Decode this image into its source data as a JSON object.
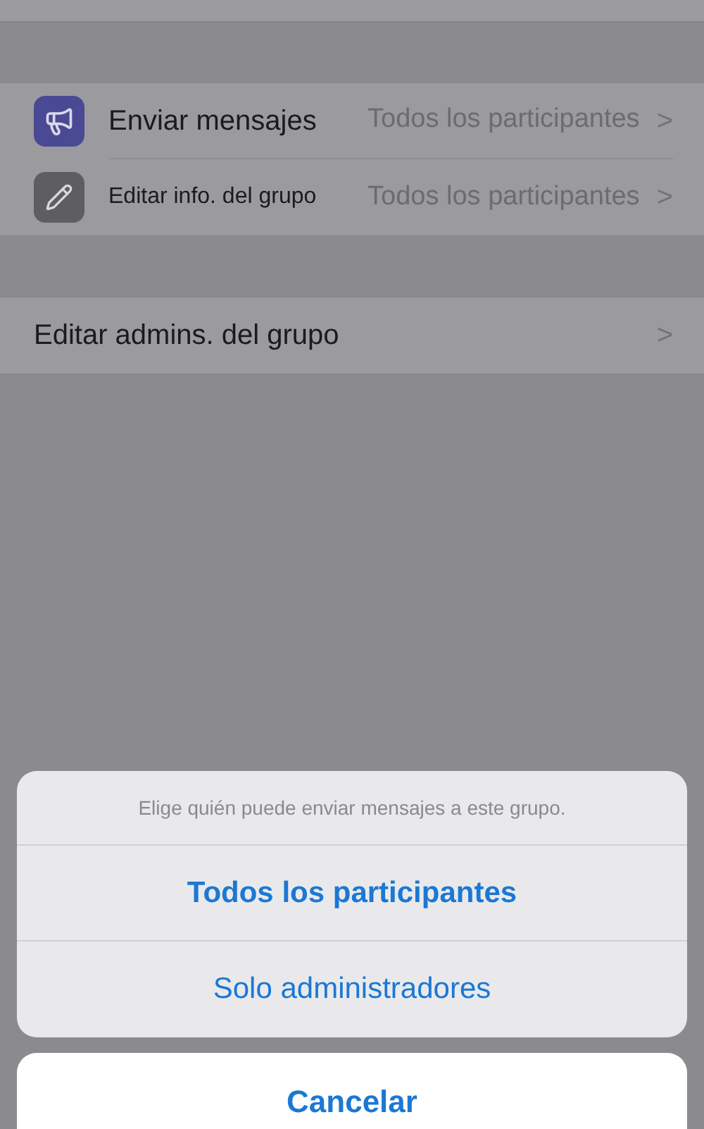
{
  "settings_group_1": [
    {
      "kind": "megaphone",
      "label": "Enviar mensajes",
      "value": "Todos los participantes",
      "chevron": ">"
    },
    {
      "kind": "pencil",
      "label": "Editar info. del grupo",
      "value": "Todos los participantes",
      "chevron": ">"
    }
  ],
  "settings_group_2": [
    {
      "label": "Editar admins. del grupo",
      "chevron": ">"
    }
  ],
  "action_sheet": {
    "message": "Elige quién puede enviar mensajes a este grupo.",
    "options": [
      {
        "label": "Todos los participantes",
        "preferred": true
      },
      {
        "label": "Solo administradores",
        "preferred": false
      }
    ],
    "cancel": "Cancelar"
  }
}
